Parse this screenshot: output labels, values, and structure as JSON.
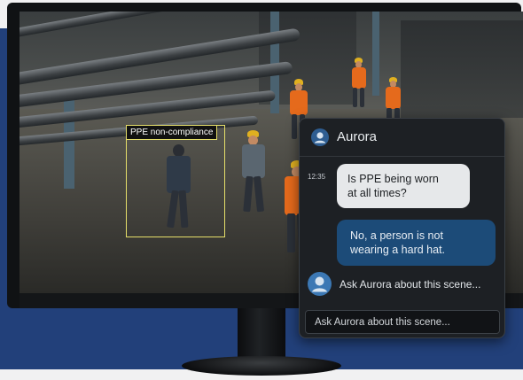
{
  "overlay": {
    "detection_label": "PPE non-compliance"
  },
  "chat": {
    "title": "Aurora",
    "messages": [
      {
        "role": "user",
        "time": "12:35",
        "text_line1": "Is PPE being worn",
        "text_line2": "at all times?"
      },
      {
        "role": "assistant",
        "text_line1": "No, a person is not",
        "text_line2": "wearing a hard hat."
      }
    ],
    "suggestion": "Ask Aurora about this scene...",
    "input_placeholder": "Ask Aurora about this scene..."
  },
  "colors": {
    "background_band": "#22407a",
    "detection_box": "#e6df6a",
    "user_bubble": "#e6e8ea",
    "assistant_bubble": "#1c4b78",
    "vest": "#e56a1c",
    "hard_hat": "#e0b020"
  },
  "icons": {
    "chat_avatar": "person-circle-icon",
    "suggestion_avatar": "person-circle-icon"
  }
}
